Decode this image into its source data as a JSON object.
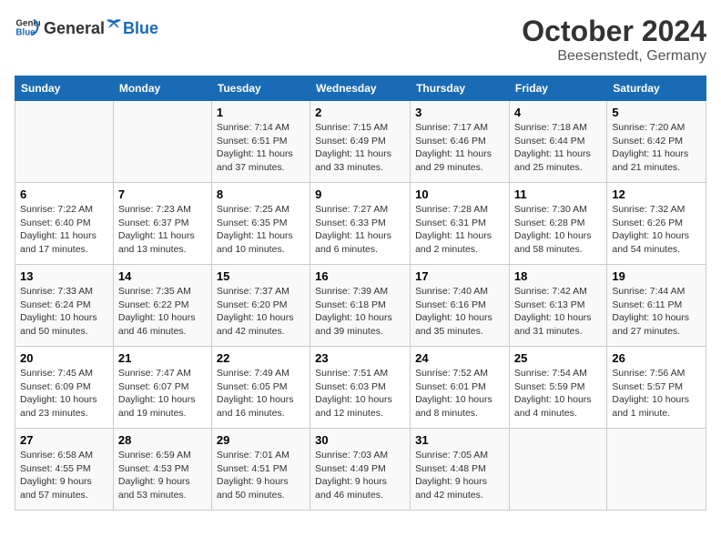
{
  "header": {
    "logo_general": "General",
    "logo_blue": "Blue",
    "month": "October 2024",
    "location": "Beesenstedt, Germany"
  },
  "days_of_week": [
    "Sunday",
    "Monday",
    "Tuesday",
    "Wednesday",
    "Thursday",
    "Friday",
    "Saturday"
  ],
  "weeks": [
    [
      {
        "day": "",
        "info": ""
      },
      {
        "day": "",
        "info": ""
      },
      {
        "day": "1",
        "info": "Sunrise: 7:14 AM\nSunset: 6:51 PM\nDaylight: 11 hours\nand 37 minutes."
      },
      {
        "day": "2",
        "info": "Sunrise: 7:15 AM\nSunset: 6:49 PM\nDaylight: 11 hours\nand 33 minutes."
      },
      {
        "day": "3",
        "info": "Sunrise: 7:17 AM\nSunset: 6:46 PM\nDaylight: 11 hours\nand 29 minutes."
      },
      {
        "day": "4",
        "info": "Sunrise: 7:18 AM\nSunset: 6:44 PM\nDaylight: 11 hours\nand 25 minutes."
      },
      {
        "day": "5",
        "info": "Sunrise: 7:20 AM\nSunset: 6:42 PM\nDaylight: 11 hours\nand 21 minutes."
      }
    ],
    [
      {
        "day": "6",
        "info": "Sunrise: 7:22 AM\nSunset: 6:40 PM\nDaylight: 11 hours\nand 17 minutes."
      },
      {
        "day": "7",
        "info": "Sunrise: 7:23 AM\nSunset: 6:37 PM\nDaylight: 11 hours\nand 13 minutes."
      },
      {
        "day": "8",
        "info": "Sunrise: 7:25 AM\nSunset: 6:35 PM\nDaylight: 11 hours\nand 10 minutes."
      },
      {
        "day": "9",
        "info": "Sunrise: 7:27 AM\nSunset: 6:33 PM\nDaylight: 11 hours\nand 6 minutes."
      },
      {
        "day": "10",
        "info": "Sunrise: 7:28 AM\nSunset: 6:31 PM\nDaylight: 11 hours\nand 2 minutes."
      },
      {
        "day": "11",
        "info": "Sunrise: 7:30 AM\nSunset: 6:28 PM\nDaylight: 10 hours\nand 58 minutes."
      },
      {
        "day": "12",
        "info": "Sunrise: 7:32 AM\nSunset: 6:26 PM\nDaylight: 10 hours\nand 54 minutes."
      }
    ],
    [
      {
        "day": "13",
        "info": "Sunrise: 7:33 AM\nSunset: 6:24 PM\nDaylight: 10 hours\nand 50 minutes."
      },
      {
        "day": "14",
        "info": "Sunrise: 7:35 AM\nSunset: 6:22 PM\nDaylight: 10 hours\nand 46 minutes."
      },
      {
        "day": "15",
        "info": "Sunrise: 7:37 AM\nSunset: 6:20 PM\nDaylight: 10 hours\nand 42 minutes."
      },
      {
        "day": "16",
        "info": "Sunrise: 7:39 AM\nSunset: 6:18 PM\nDaylight: 10 hours\nand 39 minutes."
      },
      {
        "day": "17",
        "info": "Sunrise: 7:40 AM\nSunset: 6:16 PM\nDaylight: 10 hours\nand 35 minutes."
      },
      {
        "day": "18",
        "info": "Sunrise: 7:42 AM\nSunset: 6:13 PM\nDaylight: 10 hours\nand 31 minutes."
      },
      {
        "day": "19",
        "info": "Sunrise: 7:44 AM\nSunset: 6:11 PM\nDaylight: 10 hours\nand 27 minutes."
      }
    ],
    [
      {
        "day": "20",
        "info": "Sunrise: 7:45 AM\nSunset: 6:09 PM\nDaylight: 10 hours\nand 23 minutes."
      },
      {
        "day": "21",
        "info": "Sunrise: 7:47 AM\nSunset: 6:07 PM\nDaylight: 10 hours\nand 19 minutes."
      },
      {
        "day": "22",
        "info": "Sunrise: 7:49 AM\nSunset: 6:05 PM\nDaylight: 10 hours\nand 16 minutes."
      },
      {
        "day": "23",
        "info": "Sunrise: 7:51 AM\nSunset: 6:03 PM\nDaylight: 10 hours\nand 12 minutes."
      },
      {
        "day": "24",
        "info": "Sunrise: 7:52 AM\nSunset: 6:01 PM\nDaylight: 10 hours\nand 8 minutes."
      },
      {
        "day": "25",
        "info": "Sunrise: 7:54 AM\nSunset: 5:59 PM\nDaylight: 10 hours\nand 4 minutes."
      },
      {
        "day": "26",
        "info": "Sunrise: 7:56 AM\nSunset: 5:57 PM\nDaylight: 10 hours\nand 1 minute."
      }
    ],
    [
      {
        "day": "27",
        "info": "Sunrise: 6:58 AM\nSunset: 4:55 PM\nDaylight: 9 hours\nand 57 minutes."
      },
      {
        "day": "28",
        "info": "Sunrise: 6:59 AM\nSunset: 4:53 PM\nDaylight: 9 hours\nand 53 minutes."
      },
      {
        "day": "29",
        "info": "Sunrise: 7:01 AM\nSunset: 4:51 PM\nDaylight: 9 hours\nand 50 minutes."
      },
      {
        "day": "30",
        "info": "Sunrise: 7:03 AM\nSunset: 4:49 PM\nDaylight: 9 hours\nand 46 minutes."
      },
      {
        "day": "31",
        "info": "Sunrise: 7:05 AM\nSunset: 4:48 PM\nDaylight: 9 hours\nand 42 minutes."
      },
      {
        "day": "",
        "info": ""
      },
      {
        "day": "",
        "info": ""
      }
    ]
  ]
}
